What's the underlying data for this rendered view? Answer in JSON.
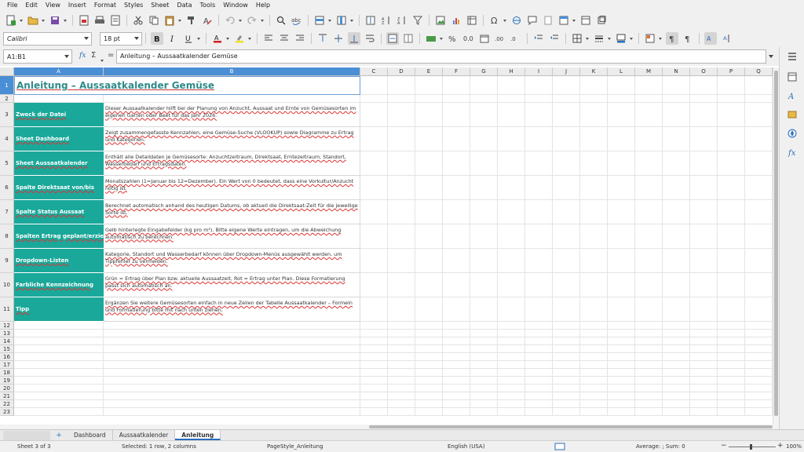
{
  "menu": [
    "File",
    "Edit",
    "View",
    "Insert",
    "Format",
    "Styles",
    "Sheet",
    "Data",
    "Tools",
    "Window",
    "Help"
  ],
  "font": {
    "name": "Calibri",
    "size": "18 pt"
  },
  "formula": {
    "cell_ref": "A1:B1",
    "fx": "fx",
    "sigma": "Σ",
    "equals": "=",
    "content": "Anleitung – Aussaatkalender Gemüse"
  },
  "columns": [
    "A",
    "B",
    "C",
    "D",
    "E",
    "F",
    "G",
    "H",
    "I",
    "J",
    "K",
    "L",
    "M",
    "N",
    "O",
    "P",
    "Q"
  ],
  "rows": [
    "1",
    "2",
    "3",
    "4",
    "5",
    "6",
    "7",
    "8",
    "9",
    "10",
    "11",
    "12",
    "13",
    "14",
    "15",
    "16",
    "17",
    "18",
    "19",
    "20",
    "21",
    "22",
    "23"
  ],
  "sheet": {
    "title": "Anleitung – Aussaatkalender Gemüse",
    "entries": [
      {
        "label": "Zweck der Datei",
        "text": "Dieser Aussaatkalender hilft bei der Planung von Anzucht, Aussaat und Ernte von Gemüsesorten im eigenen Garten oder Beet für das Jahr 2026."
      },
      {
        "label": "Sheet Dashboard",
        "text": "Zeigt zusammengefasste Kennzahlen, eine Gemüse-Suche (VLOOKUP) sowie Diagramme zu Ertrag und Kategorien."
      },
      {
        "label": "Sheet Aussaatkalender",
        "text": "Enthält alle Detaildaten je Gemüsesorte: Anzuchtzeitraum, Direktsaat, Erntezeitraum, Standort, Wasserbedarf und Ertragsdaten."
      },
      {
        "label": "Spalte Direktsaat von/bis",
        "text": "Monatszahlen (1=Januar bis 12=Dezember). Ein Wert von 0 bedeutet, dass eine Vorkultur/Anzucht nötig ist."
      },
      {
        "label": "Spalte Status Aussaat",
        "text": "Berechnet automatisch anhand des heutigen Datums, ob aktuell die Direktsaat-Zeit für die jeweilige Sorte ist."
      },
      {
        "label": "Spalten Ertrag geplant/erzielt",
        "text": "Gelb hinterlegte Eingabefelder (kg pro m²). Bitte eigene Werte eintragen, um die Abweichung automatisch zu berechnen."
      },
      {
        "label": "Dropdown-Listen",
        "text": "Kategorie, Standort und Wasserbedarf können über Dropdown-Menüs ausgewählt werden, um Tippfehler zu vermeiden."
      },
      {
        "label": "Farbliche Kennzeichnung",
        "text": "Grün = Ertrag über Plan bzw. aktuelle Aussaatzeit, Rot = Ertrag unter Plan. Diese Formatierung passt sich automatisch an."
      },
      {
        "label": "Tipp",
        "text": "Ergänzen Sie weitere Gemüsesorten einfach in neue Zeilen der Tabelle Aussaatkalender – Formeln und Formatierung bitte mit nach unten ziehen."
      }
    ]
  },
  "tabs": {
    "add": "+",
    "items": [
      "Dashboard",
      "Aussaatkalender",
      "Anleitung"
    ],
    "active": "Anleitung"
  },
  "status": {
    "sheet": "Sheet 3 of 3",
    "selection": "Selected: 1 row, 2 columns",
    "page_style": "PageStyle_Anleitung",
    "language": "English (USA)",
    "aggregate": "Average: ; Sum: 0",
    "zoom": "100%"
  },
  "colors": {
    "teal": "#1aa89a",
    "title": "#2e8b8b",
    "selection": "#4a8ed6"
  }
}
